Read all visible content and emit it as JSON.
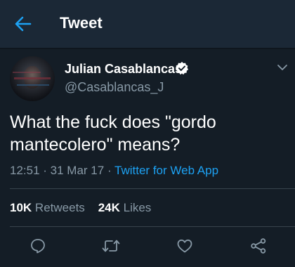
{
  "header": {
    "title": "Tweet"
  },
  "tweet": {
    "author_name": "Julian Casablancas",
    "handle": "@Casablancas_J",
    "text": "What the fuck does \"gordo mantecolero\" means?",
    "time": "12:51",
    "date": "31 Mar 17",
    "source": "Twitter for Web App",
    "retweets_count": "10K",
    "retweets_label": "Retweets",
    "likes_count": "24K",
    "likes_label": "Likes"
  },
  "colors": {
    "background": "#141d26",
    "header": "#1b2836",
    "accent": "#1da1f2",
    "muted": "#8899a6"
  },
  "icons": {
    "back": "arrow-left-icon",
    "verified": "verified-badge-icon",
    "more": "chevron-down-icon",
    "reply": "reply-icon",
    "retweet": "retweet-icon",
    "like": "heart-icon",
    "share": "share-icon"
  }
}
